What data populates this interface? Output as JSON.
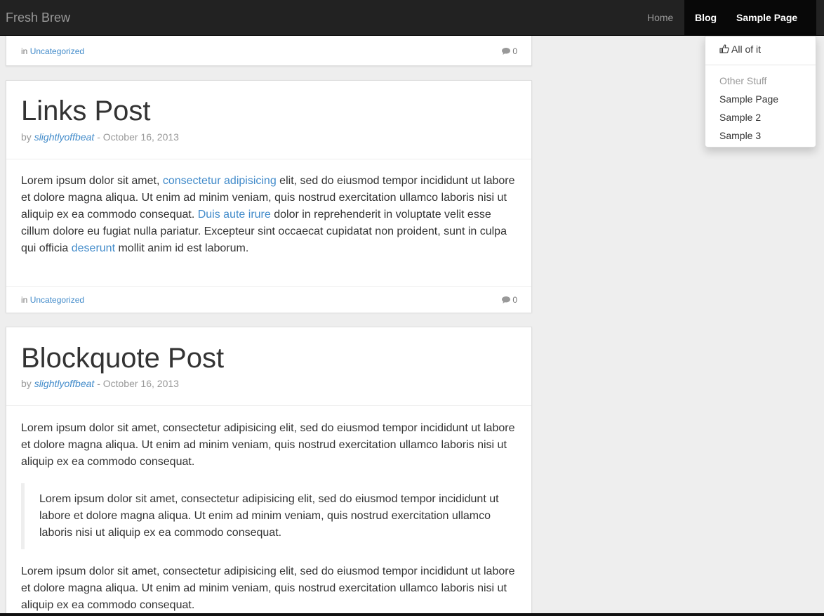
{
  "navbar": {
    "brand": "Fresh Brew",
    "home": "Home",
    "blog": "Blog",
    "sample_page": "Sample Page"
  },
  "dropdown": {
    "all_of_it": "All of it",
    "header": "Other Stuff",
    "items": [
      "Sample Page",
      "Sample 2",
      "Sample 3"
    ]
  },
  "posts": [
    {
      "footer": {
        "in": "in",
        "category": "Uncategorized",
        "comments": "0"
      }
    },
    {
      "title": "Links Post",
      "by": "by",
      "author": "slightlyoffbeat",
      "date": "- October 16, 2013",
      "body": {
        "t1": "Lorem ipsum dolor sit amet, ",
        "l1": "consectetur adipisicing",
        "t2": " elit, sed do eiusmod tempor incididunt ut labore et dolore magna aliqua. Ut enim ad minim veniam, quis nostrud exercitation ullamco laboris nisi ut aliquip ex ea commodo consequat. ",
        "l2": "Duis aute irure",
        "t3": " dolor in reprehenderit in voluptate velit esse cillum dolore eu fugiat nulla pariatur. Excepteur sint occaecat cupidatat non proident, sunt in culpa qui officia ",
        "l3": "deserunt",
        "t4": " mollit anim id est laborum."
      },
      "footer": {
        "in": "in",
        "category": "Uncategorized",
        "comments": "0"
      }
    },
    {
      "title": "Blockquote Post",
      "by": "by",
      "author": "slightlyoffbeat",
      "date": "- October 16, 2013",
      "p1": "Lorem ipsum dolor sit amet, consectetur adipisicing elit, sed do eiusmod tempor incididunt ut labore et dolore magna aliqua. Ut enim ad minim veniam, quis nostrud exercitation ullamco laboris nisi ut aliquip ex ea commodo consequat.",
      "quote": "Lorem ipsum dolor sit amet, consectetur adipisicing elit, sed do eiusmod tempor incididunt ut labore et dolore magna aliqua. Ut enim ad minim veniam, quis nostrud exercitation ullamco laboris nisi ut aliquip ex ea commodo consequat.",
      "p2": "Lorem ipsum dolor sit amet, consectetur adipisicing elit, sed do eiusmod tempor incididunt ut labore et dolore magna aliqua. Ut enim ad minim veniam, quis nostrud exercitation ullamco laboris nisi ut aliquip ex ea commodo consequat."
    }
  ]
}
